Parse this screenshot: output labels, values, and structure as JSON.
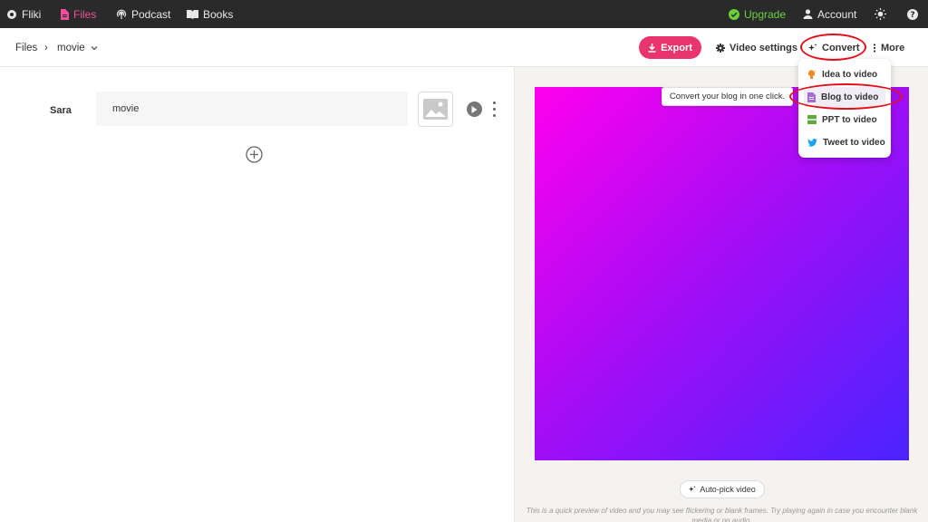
{
  "topbar": {
    "brand": "Fliki",
    "nav": [
      {
        "label": "Files",
        "icon": "file-icon",
        "active": true
      },
      {
        "label": "Podcast",
        "icon": "podcast-icon",
        "active": false
      },
      {
        "label": "Books",
        "icon": "book-icon",
        "active": false
      }
    ],
    "upgrade_label": "Upgrade",
    "account_label": "Account",
    "theme_icon": "sun-icon",
    "help_icon": "help-icon"
  },
  "header": {
    "breadcrumb_root": "Files",
    "breadcrumb_sep": "›",
    "breadcrumb_current": "movie",
    "export_label": "Export",
    "video_settings_label": "Video settings",
    "convert_label": "Convert",
    "more_label": "More"
  },
  "editor": {
    "speaker": "Sara",
    "scene_text": "movie"
  },
  "preview": {
    "gradient_colors": [
      "#ff00ee",
      "#a80cf5",
      "#4a24ff"
    ],
    "autopick_label": "Auto-pick video",
    "footnote": "This is a quick preview of video and you may see flickering or blank frames. Try playing again in case you encounter blank media or no audio."
  },
  "convert_menu": {
    "tooltip": "Convert your blog in one click.",
    "items": [
      {
        "label": "Idea to video",
        "icon": "lightbulb-icon",
        "color": "#f08a24"
      },
      {
        "label": "Blog to video",
        "icon": "document-icon",
        "color": "#a46bd9",
        "selected": true
      },
      {
        "label": "PPT to video",
        "icon": "slides-icon",
        "color": "#5fa83b"
      },
      {
        "label": "Tweet to video",
        "icon": "twitter-icon",
        "color": "#1da1f2"
      }
    ]
  },
  "colors": {
    "accent": "#e8356d",
    "active_nav": "#f0509b",
    "upgrade": "#6bd13b",
    "annotation": "#e3101c"
  }
}
